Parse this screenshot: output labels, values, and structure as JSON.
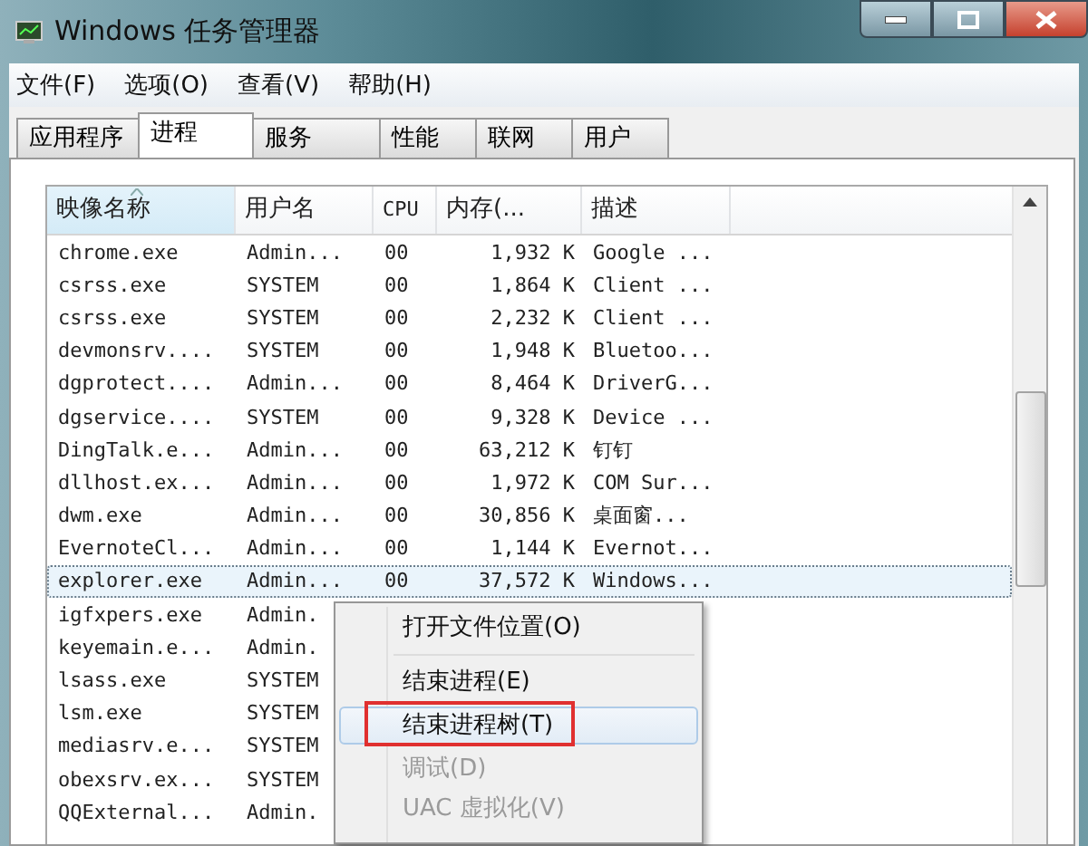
{
  "window": {
    "title": "Windows 任务管理器"
  },
  "menu": [
    "文件(F)",
    "选项(O)",
    "查看(V)",
    "帮助(H)"
  ],
  "tabs": [
    {
      "label": "应用程序",
      "selected": false
    },
    {
      "label": "进程",
      "selected": true
    },
    {
      "label": "服务",
      "selected": false
    },
    {
      "label": "性能",
      "selected": false
    },
    {
      "label": "联网",
      "selected": false
    },
    {
      "label": "用户",
      "selected": false
    }
  ],
  "table": {
    "columns": [
      {
        "label": "映像名称",
        "sorted": true
      },
      {
        "label": "用户名",
        "sorted": false
      },
      {
        "label": "CPU",
        "sorted": false
      },
      {
        "label": "内存(...",
        "sorted": false
      },
      {
        "label": "描述",
        "sorted": false
      }
    ],
    "rows": [
      {
        "cells": [
          "chrome.exe",
          "Admin...",
          "00",
          "1,932 K",
          "Google ..."
        ],
        "selected": false
      },
      {
        "cells": [
          "csrss.exe",
          "SYSTEM",
          "00",
          "1,864 K",
          "Client ..."
        ],
        "selected": false
      },
      {
        "cells": [
          "csrss.exe",
          "SYSTEM",
          "00",
          "2,232 K",
          "Client ..."
        ],
        "selected": false
      },
      {
        "cells": [
          "devmonsrv....",
          "SYSTEM",
          "00",
          "1,948 K",
          "Bluetoo..."
        ],
        "selected": false
      },
      {
        "cells": [
          "dgprotect....",
          "Admin...",
          "00",
          "8,464 K",
          "DriverG..."
        ],
        "selected": false
      },
      {
        "cells": [
          "dgservice....",
          "SYSTEM",
          "00",
          "9,328 K",
          "Device ..."
        ],
        "selected": false
      },
      {
        "cells": [
          "DingTalk.e...",
          "Admin...",
          "00",
          "63,212 K",
          "钉钉"
        ],
        "selected": false
      },
      {
        "cells": [
          "dllhost.ex...",
          "Admin...",
          "00",
          "1,972 K",
          "COM Sur..."
        ],
        "selected": false
      },
      {
        "cells": [
          "dwm.exe",
          "Admin...",
          "00",
          "30,856 K",
          "桌面窗..."
        ],
        "selected": false
      },
      {
        "cells": [
          "EvernoteCl...",
          "Admin...",
          "00",
          "1,144 K",
          "Evernot..."
        ],
        "selected": false
      },
      {
        "cells": [
          "explorer.exe",
          "Admin...",
          "00",
          "37,572 K",
          "Windows..."
        ],
        "selected": true
      },
      {
        "cells": [
          "igfxpers.exe",
          "Admin."
        ],
        "selected": false
      },
      {
        "cells": [
          "keyemain.e...",
          "Admin."
        ],
        "selected": false
      },
      {
        "cells": [
          "lsass.exe",
          "SYSTEM"
        ],
        "selected": false
      },
      {
        "cells": [
          "lsm.exe",
          "SYSTEM"
        ],
        "selected": false
      },
      {
        "cells": [
          "mediasrv.e...",
          "SYSTEM"
        ],
        "selected": false
      },
      {
        "cells": [
          "obexsrv.ex...",
          "SYSTEM"
        ],
        "selected": false
      },
      {
        "cells": [
          "QQExternal...",
          "Admin."
        ],
        "selected": false
      }
    ]
  },
  "context_menu": {
    "items": [
      {
        "kind": "item",
        "label": "打开文件位置(O)",
        "disabled": false,
        "selected": false,
        "marked": false
      },
      {
        "kind": "separator"
      },
      {
        "kind": "item",
        "label": "结束进程(E)",
        "disabled": false,
        "selected": false,
        "marked": false
      },
      {
        "kind": "item",
        "label": "结束进程树(T)",
        "disabled": false,
        "selected": true,
        "marked": true
      },
      {
        "kind": "item",
        "label": "调试(D)",
        "disabled": true,
        "selected": false,
        "marked": false
      },
      {
        "kind": "item",
        "label": "UAC 虚拟化(V)",
        "disabled": true,
        "selected": false,
        "marked": false
      }
    ]
  }
}
